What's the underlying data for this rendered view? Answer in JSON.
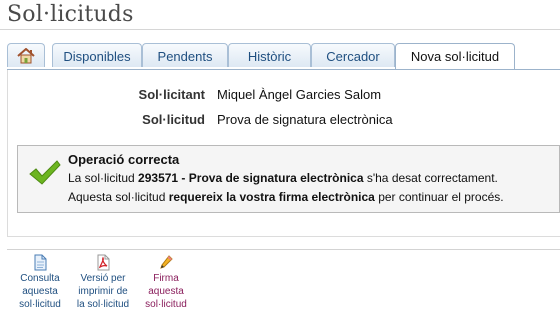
{
  "page": {
    "title": "Sol·licituds"
  },
  "tabs": [
    {
      "label": "Disponibles"
    },
    {
      "label": "Pendents"
    },
    {
      "label": "Històric"
    },
    {
      "label": "Cercador"
    },
    {
      "label": "Nova sol·licitud",
      "active": true
    }
  ],
  "fields": {
    "applicant_label": "Sol·licitant",
    "applicant_value": "Miquel Àngel Garcies Salom",
    "request_label": "Sol·licitud",
    "request_value": "Prova de signatura electrònica"
  },
  "message": {
    "title": "Operació correcta",
    "line1_prefix": "La sol·licitud",
    "line1_id": "293571",
    "line1_sep": " - ",
    "line1_name": "Prova de signatura electrònica",
    "line1_suffix": "s'ha desat correctament.",
    "line2_prefix": "Aquesta sol·licitud",
    "line2_bold": "requereix la vostra firma electrònica",
    "line2_suffix": "per continuar el procés."
  },
  "actions": [
    {
      "line1": "Consulta",
      "line2": "aquesta",
      "line3": "sol·licitud",
      "icon": "document-icon"
    },
    {
      "line1": "Versió per",
      "line2": "imprimir de",
      "line3": "la sol·licitud",
      "icon": "pdf-icon"
    },
    {
      "line1": "Firma",
      "line2": "aquesta",
      "line3": "sol·licitud",
      "icon": "pencil-icon"
    }
  ],
  "colors": {
    "tab_text": "#1f4f80",
    "success_check": "#6cb520",
    "firma_action": "#8a1e5c"
  }
}
